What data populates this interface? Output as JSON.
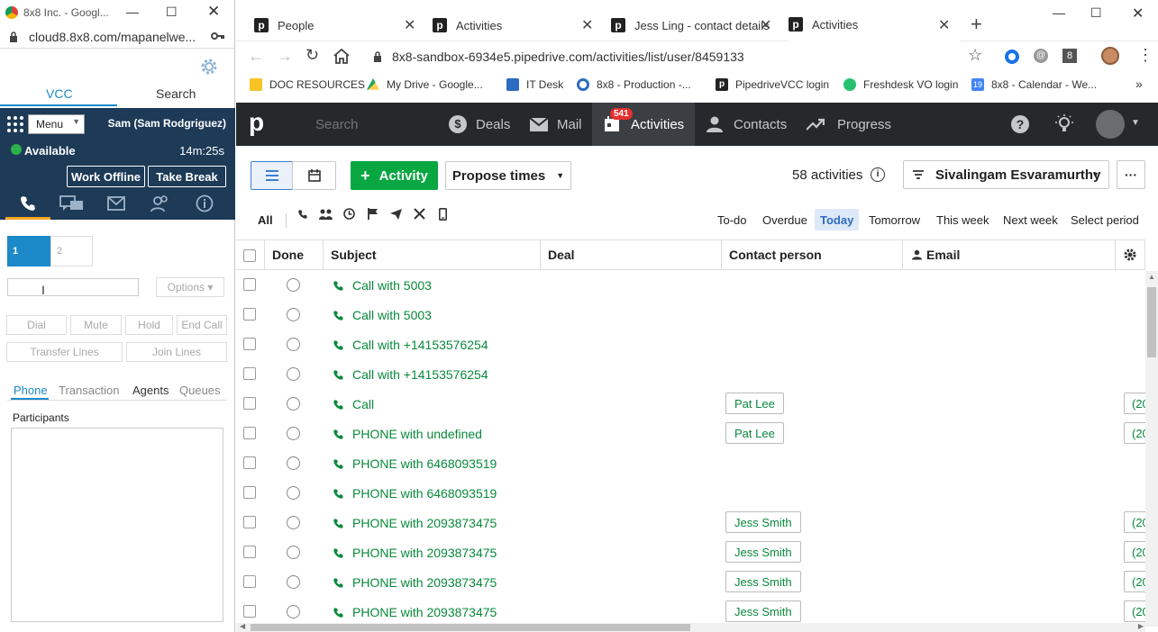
{
  "left_window": {
    "title": "8x8 Inc. - Googl...",
    "url": "cloud8.8x8.com/mapanelwe...",
    "tabs": [
      "VCC",
      "Search"
    ],
    "menu_label": "Menu",
    "agent_name": "Sam (Sam Rodgriguez)",
    "status": "Available",
    "timer": "14m:25s",
    "work_offline": "Work Offline",
    "take_break": "Take Break",
    "line1": "1",
    "line2": "2",
    "options": "Options ▾",
    "dial": "Dial",
    "mute": "Mute",
    "hold": "Hold",
    "end_call": "End Call",
    "transfer": "Transfer Lines",
    "join": "Join Lines",
    "subtabs": [
      "Phone",
      "Transaction",
      "Agents",
      "Queues"
    ],
    "participants": "Participants"
  },
  "browser": {
    "tabs": [
      {
        "label": "People"
      },
      {
        "label": "Activities"
      },
      {
        "label": "Jess Ling - contact details"
      },
      {
        "label": "Activities"
      }
    ],
    "url": "8x8-sandbox-6934e5.pipedrive.com/activities/list/user/8459133",
    "extension_badge": "8",
    "bookmarks": [
      {
        "label": "DOC RESOURCES",
        "color": "#f7c325"
      },
      {
        "label": "My Drive - Google...",
        "color": "#1fa463"
      },
      {
        "label": "IT Desk",
        "color": "#2d6cc0"
      },
      {
        "label": "8x8 - Production -...",
        "color": "#2d6cc0"
      },
      {
        "label": "PipedriveVCC login",
        "color": "#222222"
      },
      {
        "label": "Freshdesk VO login",
        "color": "#25c16f"
      },
      {
        "label": "8x8 - Calendar - We...",
        "color": "#4285f4"
      }
    ],
    "calendar_icon_text": "19"
  },
  "pipedrive": {
    "logo": "p",
    "search_placeholder": "Search",
    "nav": {
      "deals": "Deals",
      "mail": "Mail",
      "activities": "Activities",
      "activities_badge": "541",
      "contacts": "Contacts",
      "progress": "Progress"
    },
    "add_activity": "Activity",
    "propose_times": "Propose times",
    "activity_count": "58 activities",
    "owner_filter": "Sivalingam Esvaramurthy",
    "type_filter_all": "All",
    "period_filters": [
      "To-do",
      "Overdue",
      "Today",
      "Tomorrow",
      "This week",
      "Next week",
      "Select period"
    ],
    "active_period": "Today",
    "columns": {
      "done": "Done",
      "subject": "Subject",
      "deal": "Deal",
      "contact": "Contact person",
      "email": "Email"
    },
    "rows": [
      {
        "subject": "Call with 5003",
        "contact": "",
        "email": ""
      },
      {
        "subject": "Call with 5003",
        "contact": "",
        "email": ""
      },
      {
        "subject": "Call with +14153576254",
        "contact": "",
        "email": ""
      },
      {
        "subject": "Call with +14153576254",
        "contact": "",
        "email": ""
      },
      {
        "subject": "Call",
        "contact": "Pat Lee",
        "email": "(20"
      },
      {
        "subject": "PHONE with undefined",
        "contact": "Pat Lee",
        "email": "(20"
      },
      {
        "subject": "PHONE with 6468093519",
        "contact": "",
        "email": ""
      },
      {
        "subject": "PHONE with 6468093519",
        "contact": "",
        "email": ""
      },
      {
        "subject": "PHONE with 2093873475",
        "contact": "Jess Smith",
        "email": "(20"
      },
      {
        "subject": "PHONE with 2093873475",
        "contact": "Jess Smith",
        "email": "(20"
      },
      {
        "subject": "PHONE with 2093873475",
        "contact": "Jess Smith",
        "email": "(20"
      },
      {
        "subject": "PHONE with 2093873475",
        "contact": "Jess Smith",
        "email": "(20"
      }
    ]
  }
}
